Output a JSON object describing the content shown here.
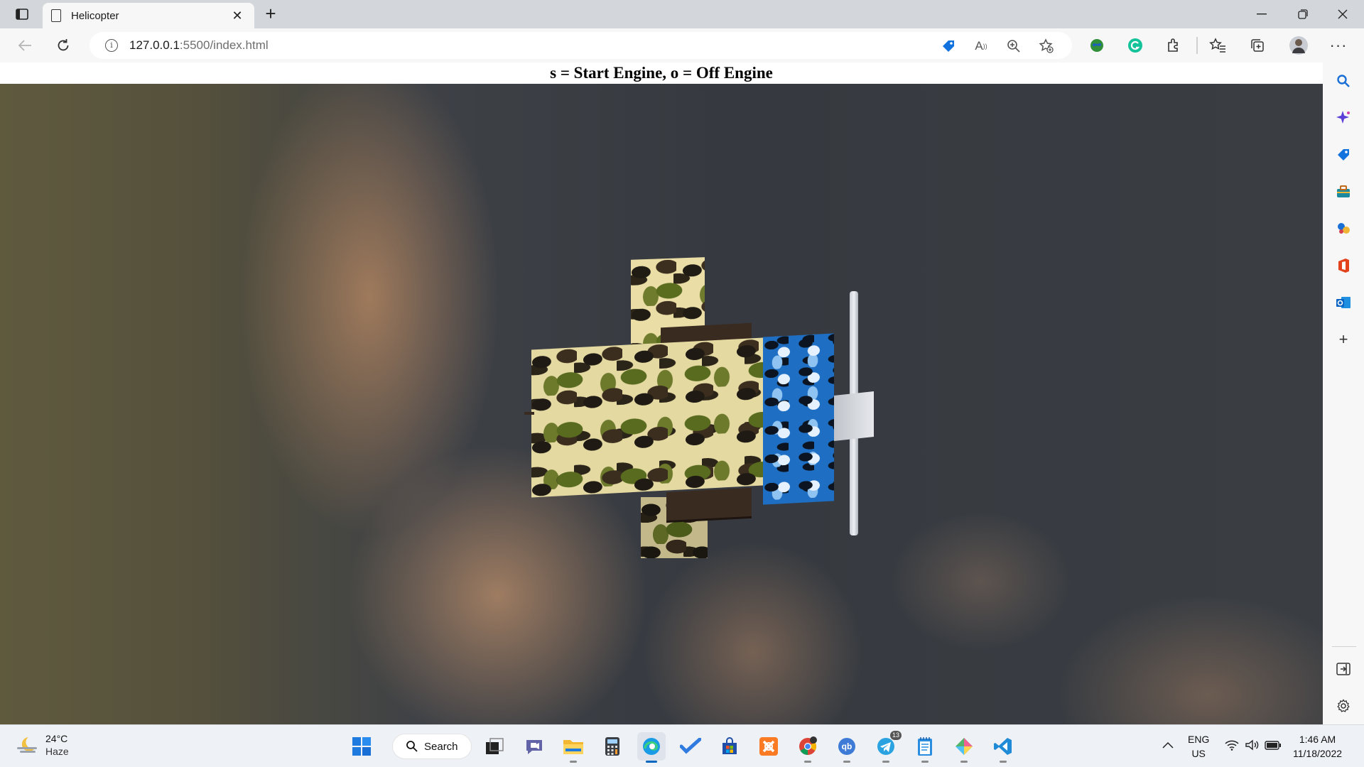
{
  "browser": {
    "tab_title": "Helicopter",
    "url_host": "127.0.0.1",
    "url_path": ":5500/index.html",
    "new_tab": "+",
    "close_tab": "✕"
  },
  "page": {
    "heading": "s = Start Engine, o = Off Engine"
  },
  "taskbar": {
    "weather_temp": "24°C",
    "weather_condition": "Haze",
    "search_label": "Search",
    "lang_top": "ENG",
    "lang_bottom": "US",
    "time": "1:46 AM",
    "date": "11/18/2022",
    "telegram_badge": "13",
    "apps": [
      "start-menu",
      "search",
      "task-view",
      "teams-chat",
      "file-explorer",
      "calculator",
      "edge",
      "todo",
      "store",
      "xampp",
      "chrome",
      "qbittorrent",
      "telegram",
      "notepad",
      "git-kraken",
      "vscode"
    ]
  },
  "sidebar": {
    "items": [
      "search",
      "copilot",
      "shopping",
      "tools",
      "games",
      "office",
      "outlook",
      "add"
    ]
  },
  "colors": {
    "accent": "#0067c0",
    "page_bg": "#ffffff",
    "scene_bg": "#3a3e43"
  }
}
